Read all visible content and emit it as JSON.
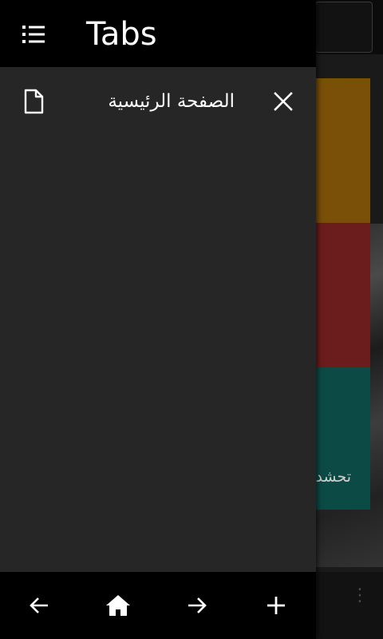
{
  "drawer": {
    "title": "Tabs",
    "tabs": [
      {
        "title": "الصفحة الرئيسية"
      }
    ]
  },
  "background_page": {
    "card_text": "تحشد"
  },
  "icons": {
    "menu": "list-icon",
    "tab": "document-icon",
    "close": "close-icon",
    "back": "arrow-left-icon",
    "home": "home-icon",
    "forward": "arrow-right-icon",
    "new_tab": "plus-icon",
    "overflow": "more-vertical-icon"
  },
  "colors": {
    "drawer_bg": "#262626",
    "header_bg": "#000000",
    "card_orange": "#7a4f07",
    "card_red": "#6b1c1c",
    "card_teal": "#0b4a45"
  }
}
